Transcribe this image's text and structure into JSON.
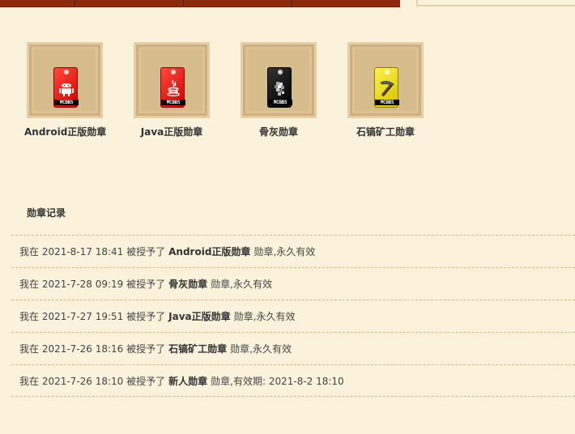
{
  "medals": [
    {
      "name": "Android正版勋章",
      "brand": "MCBBS",
      "color": "red",
      "icon": "android-icon"
    },
    {
      "name": "Java正版勋章",
      "brand": "MCBBS",
      "color": "red",
      "icon": "java-icon"
    },
    {
      "name": "骨灰勋章",
      "brand": "MCBBS",
      "color": "dark",
      "icon": "ash-icon"
    },
    {
      "name": "石镐矿工勋章",
      "brand": "MCBBS",
      "color": "yellow",
      "icon": "pickaxe-icon"
    }
  ],
  "records_title": "勋章记录",
  "records": [
    {
      "prefix": "我在 2021-8-17 18:41 被授予了",
      "medal": "Android正版勋章",
      "suffix": "勋章,永久有效"
    },
    {
      "prefix": "我在 2021-7-28 09:19 被授予了",
      "medal": "骨灰勋章",
      "suffix": "勋章,永久有效"
    },
    {
      "prefix": "我在 2021-7-27 19:51 被授予了",
      "medal": "Java正版勋章",
      "suffix": "勋章,永久有效"
    },
    {
      "prefix": "我在 2021-7-26 18:16 被授予了",
      "medal": "石镐矿工勋章",
      "suffix": "勋章,永久有效"
    },
    {
      "prefix": "我在 2021-7-26 18:10 被授予了",
      "medal": "新人勋章",
      "suffix": "勋章,有效期: 2021-8-2 18:10"
    }
  ],
  "colors": {
    "background": "#fbf2db",
    "topbar": "#8e2a0c",
    "frame": "#d6bc8b"
  }
}
